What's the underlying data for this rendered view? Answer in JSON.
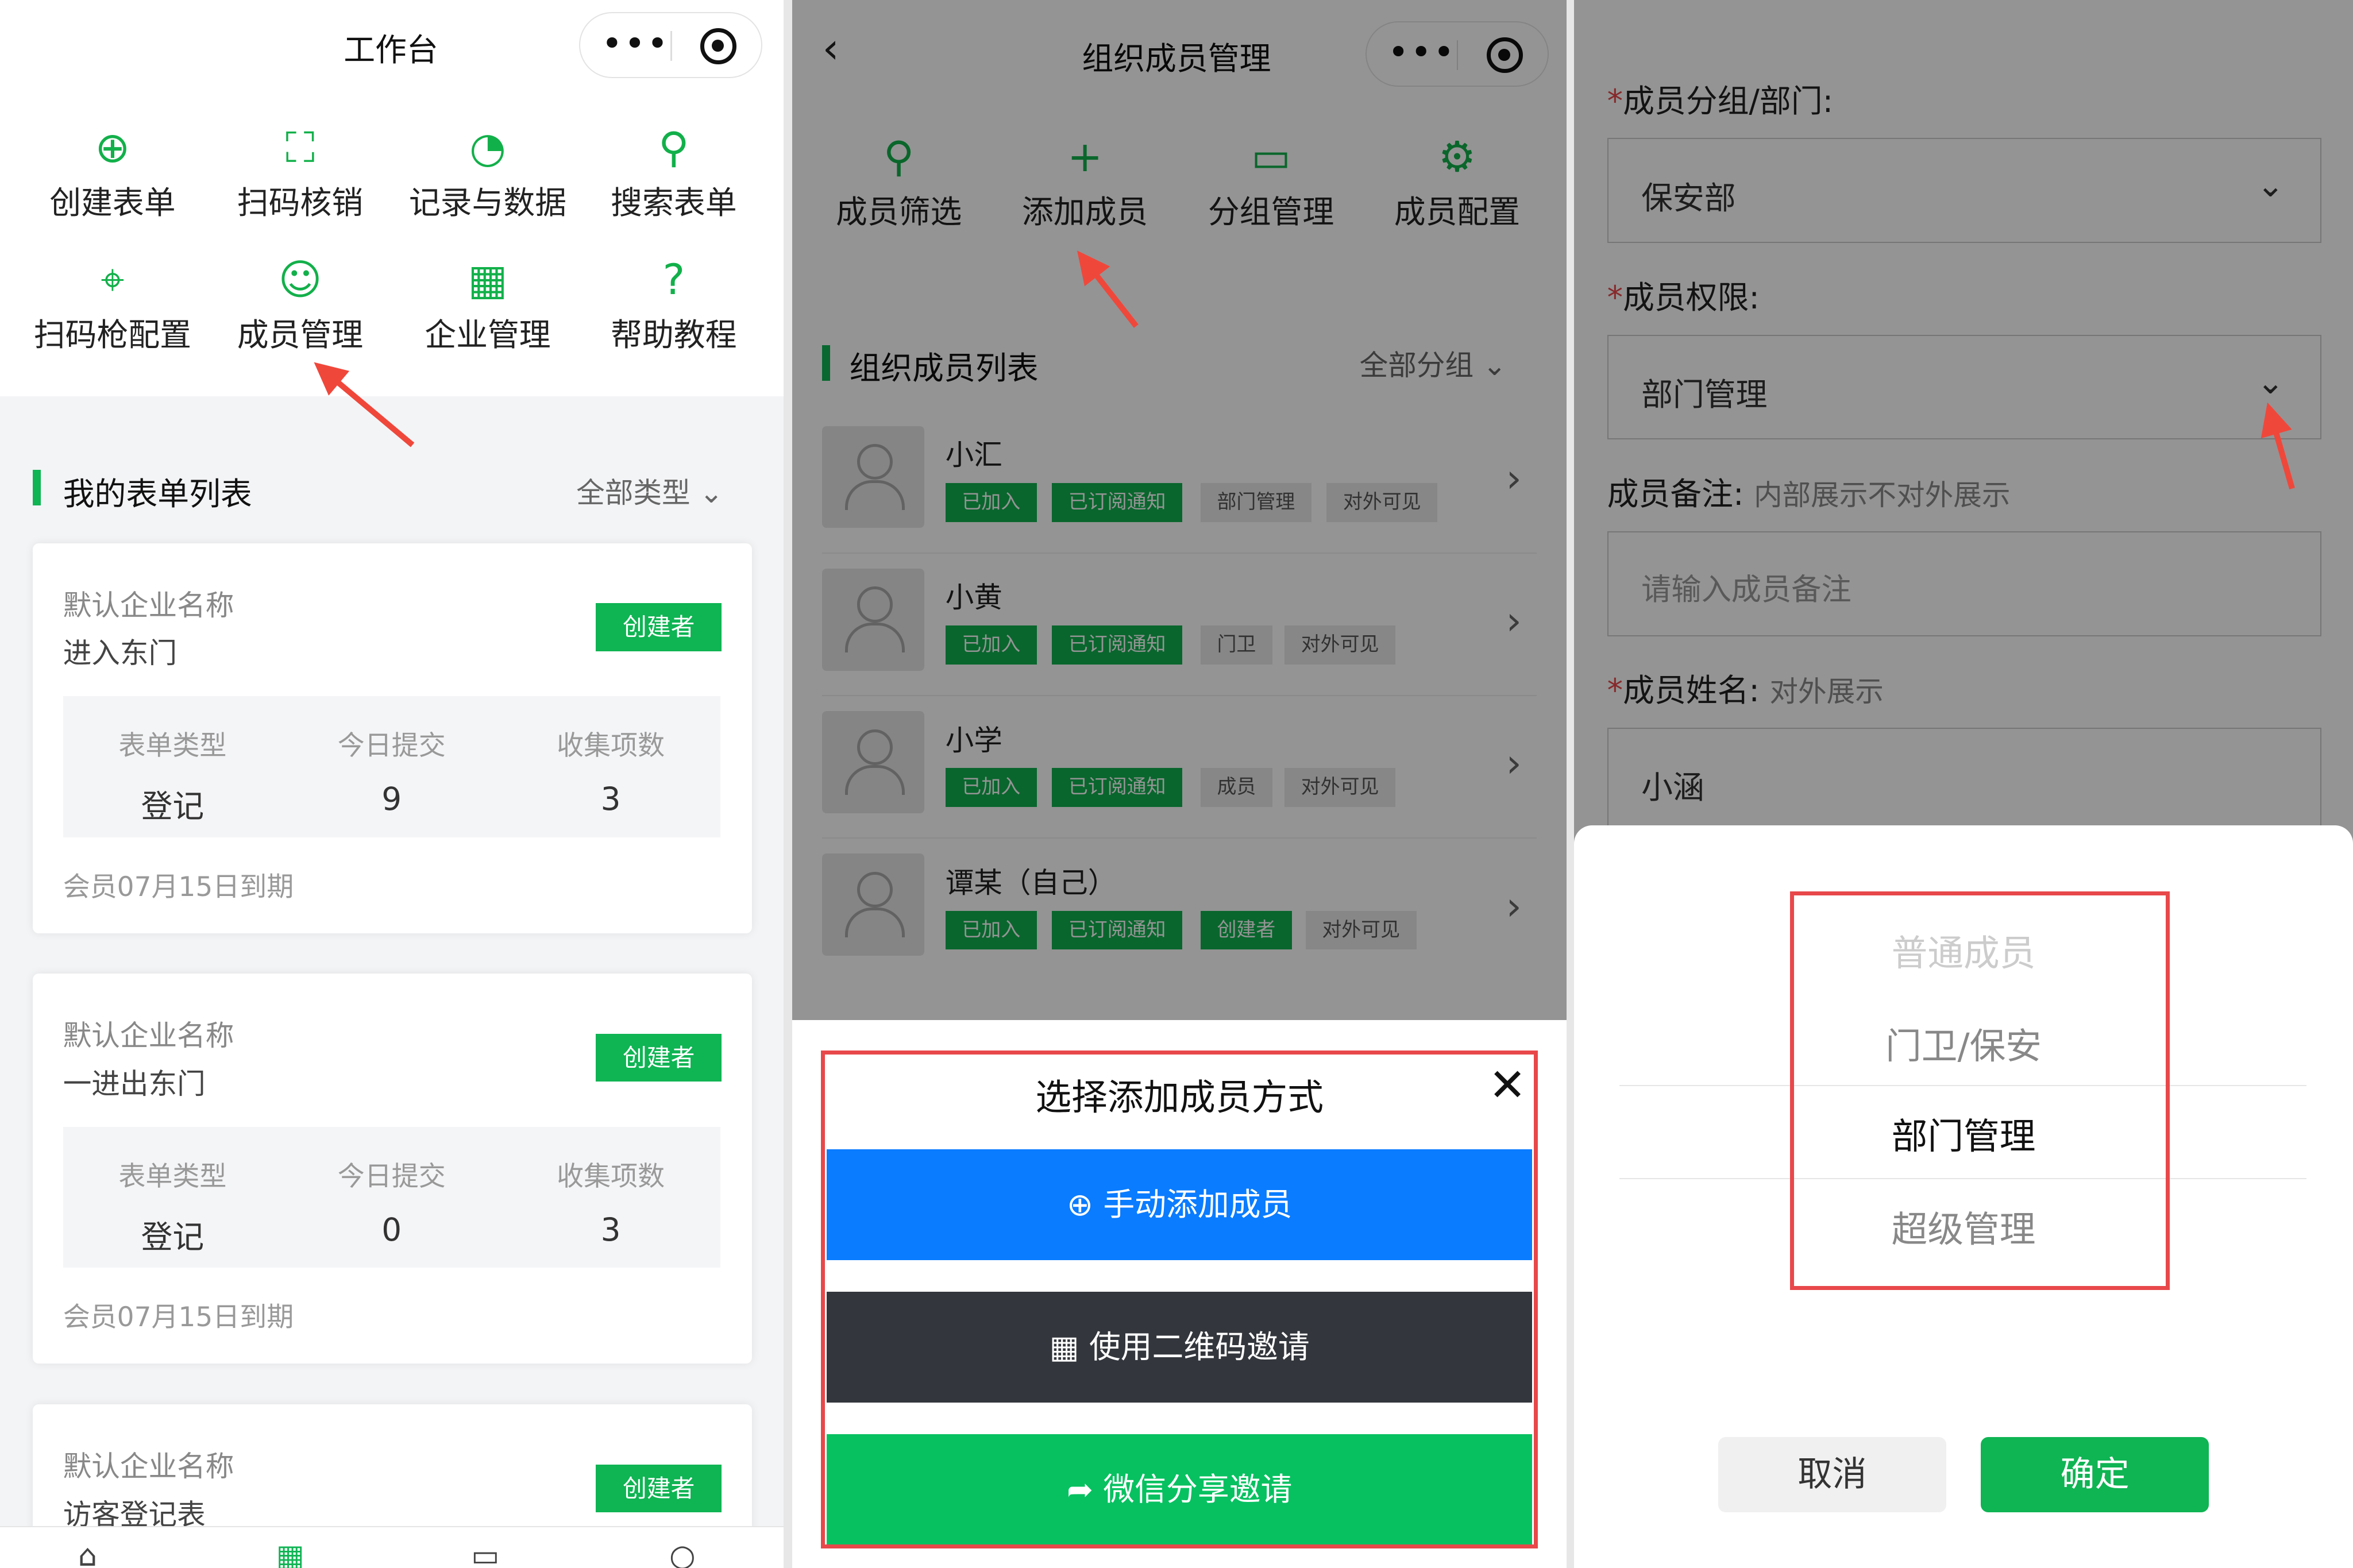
{
  "panel1": {
    "title": "工作台",
    "grid": [
      {
        "icon": "plus-circle-icon",
        "glyph": "⊕",
        "label": "创建表单"
      },
      {
        "icon": "scan-icon",
        "glyph": "⛶",
        "label": "扫码核销"
      },
      {
        "icon": "pie-chart-icon",
        "glyph": "◔",
        "label": "记录与数据"
      },
      {
        "icon": "user-search-icon",
        "glyph": "⚲",
        "label": "搜索表单"
      },
      {
        "icon": "scanner-gun-icon",
        "glyph": "⌖",
        "label": "扫码枪配置"
      },
      {
        "icon": "members-icon",
        "glyph": "☺",
        "label": "成员管理"
      },
      {
        "icon": "building-icon",
        "glyph": "▦",
        "label": "企业管理"
      },
      {
        "icon": "help-icon",
        "glyph": "?",
        "label": "帮助教程"
      }
    ],
    "list_title": "我的表单列表",
    "list_filter": "全部类型",
    "cards": [
      {
        "org": "默认企业名称",
        "name": "进入东门",
        "badge": "创建者",
        "stats": [
          {
            "k": "表单类型",
            "v": "登记"
          },
          {
            "k": "今日提交",
            "v": "9"
          },
          {
            "k": "收集项数",
            "v": "3"
          }
        ],
        "expiry": "会员07月15日到期"
      },
      {
        "org": "默认企业名称",
        "name": "一进出东门",
        "badge": "创建者",
        "stats": [
          {
            "k": "表单类型",
            "v": "登记"
          },
          {
            "k": "今日提交",
            "v": "0"
          },
          {
            "k": "收集项数",
            "v": "3"
          }
        ],
        "expiry": "会员07月15日到期"
      },
      {
        "org": "默认企业名称",
        "name": "访客登记表",
        "badge": "创建者"
      }
    ]
  },
  "panel2": {
    "title": "组织成员管理",
    "grid": [
      {
        "icon": "member-filter-icon",
        "glyph": "⚲",
        "label": "成员筛选"
      },
      {
        "icon": "add-member-icon",
        "glyph": "+",
        "label": "添加成员"
      },
      {
        "icon": "group-manage-icon",
        "glyph": "▭",
        "label": "分组管理"
      },
      {
        "icon": "member-config-icon",
        "glyph": "⚙",
        "label": "成员配置"
      }
    ],
    "list_title": "组织成员列表",
    "list_filter": "全部分组",
    "members": [
      {
        "name": "小汇",
        "tags": [
          "已加入",
          "已订阅通知",
          "部门管理",
          "对外可见"
        ]
      },
      {
        "name": "小黄",
        "tags": [
          "已加入",
          "已订阅通知",
          "门卫",
          "对外可见"
        ]
      },
      {
        "name": "小学",
        "tags": [
          "已加入",
          "已订阅通知",
          "成员",
          "对外可见"
        ]
      },
      {
        "name": "谭某（自己）",
        "tags": [
          "已加入",
          "已订阅通知",
          "创建者",
          "对外可见"
        ]
      }
    ],
    "sheet": {
      "title": "选择添加成员方式",
      "buttons": [
        {
          "icon": "plus-circle-icon",
          "glyph": "⊕",
          "label": "手动添加成员",
          "color": "#0a7cff"
        },
        {
          "icon": "qrcode-icon",
          "glyph": "▦",
          "label": "使用二维码邀请",
          "color": "#33363c"
        },
        {
          "icon": "share-icon",
          "glyph": "➦",
          "label": "微信分享邀请",
          "color": "#07c160"
        }
      ]
    }
  },
  "panel3": {
    "fields": [
      {
        "label": "成员分组/部门:",
        "required": true,
        "value": "保安部"
      },
      {
        "label": "成员权限:",
        "required": true,
        "value": "部门管理"
      },
      {
        "label": "成员备注:",
        "hint": "内部展示不对外展示",
        "placeholder": "请输入成员备注"
      },
      {
        "label": "成员姓名:",
        "required": true,
        "hint": "对外展示",
        "value": "小涵"
      }
    ],
    "picker": {
      "options": [
        "普通成员",
        "门卫/保安",
        "部门管理",
        "超级管理"
      ],
      "selected": "部门管理",
      "cancel": "取消",
      "confirm": "确定"
    }
  },
  "colors": {
    "brand_green": "#0fb453",
    "highlight_red": "#e8484a"
  }
}
